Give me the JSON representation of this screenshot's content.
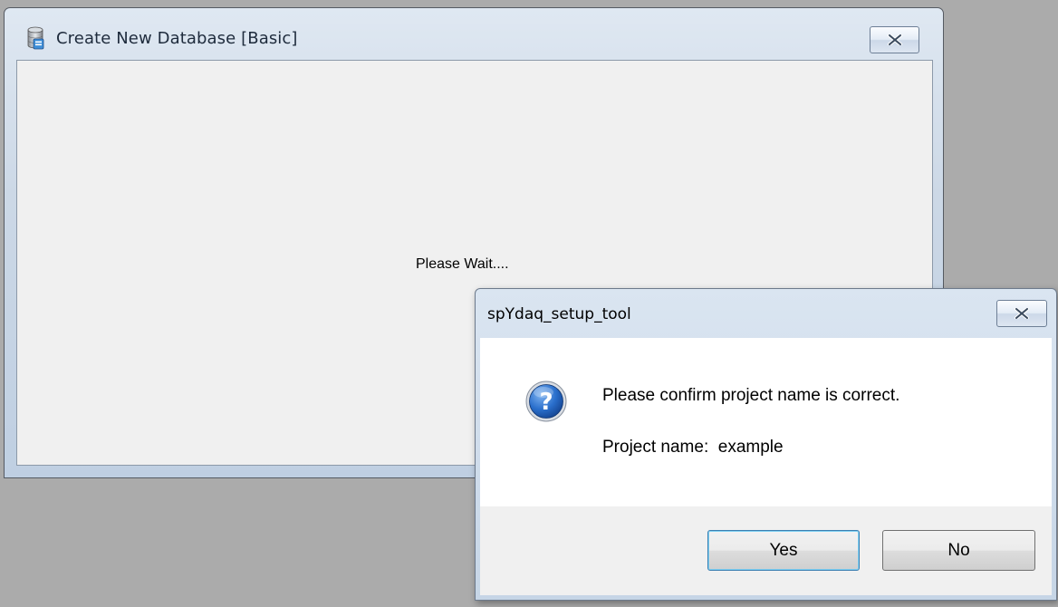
{
  "main_window": {
    "title": "Create New Database [Basic]",
    "icon": "database-icon",
    "close_icon": "close-icon",
    "status_text": "Please Wait...."
  },
  "msgbox": {
    "title": "spYdaq_setup_tool",
    "close_icon": "close-icon",
    "icon": "question-icon",
    "message_line1": "Please confirm project name is correct.",
    "message_line2": "Project name:  example",
    "yes_label": "Yes",
    "no_label": "No"
  },
  "colors": {
    "desktop": "#ababab",
    "titlebar": "#ccd8e6",
    "client": "#f0f0f0",
    "question_icon_blue": "#1f5fb8",
    "default_button_border": "#3c7fb1"
  }
}
